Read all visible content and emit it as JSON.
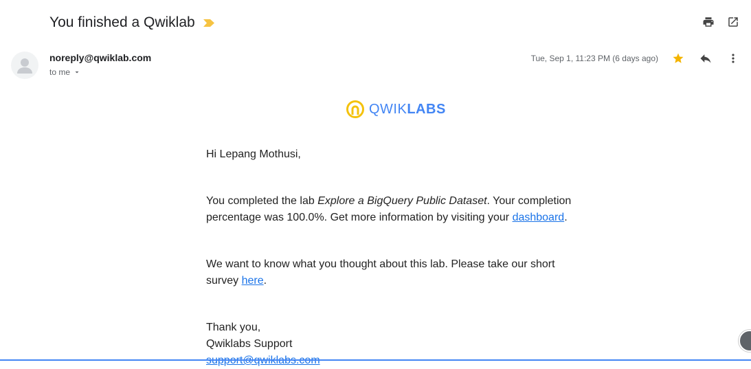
{
  "subject": "You finished a Qwiklab",
  "sender": {
    "email": "noreply@qwiklab.com",
    "to_label": "to me"
  },
  "date": "Tue, Sep 1, 11:23 PM (6 days ago)",
  "logo": {
    "part1": "QWIK",
    "part2": "LABS"
  },
  "body": {
    "greeting": "Hi Lepang Mothusi,",
    "p1_a": "You completed the lab ",
    "p1_lab": "Explore a BigQuery Public Dataset",
    "p1_b": ". Your completion percentage was 100.0%. Get more information by visiting your ",
    "p1_link": "dashboard",
    "p1_end": ".",
    "p2_a": "We want to know what you thought about this lab. Please take our short survey ",
    "p2_link": "here",
    "p2_end": ".",
    "closing": "Thank you,",
    "signature": "Qwiklabs Support",
    "support_email": "support@qwiklabs.com"
  },
  "colors": {
    "star": "#f4b400",
    "label_tag": "#f6c342",
    "link": "#1a73e8",
    "logo_blue": "#4285f4",
    "logo_yellow": "#f4c20d"
  },
  "icons": [
    "label-tag-icon",
    "print-icon",
    "open-new-window-icon",
    "avatar-placeholder-icon",
    "chevron-down-icon",
    "star-icon",
    "reply-icon",
    "more-vert-icon",
    "qwiklabs-logo-icon"
  ]
}
